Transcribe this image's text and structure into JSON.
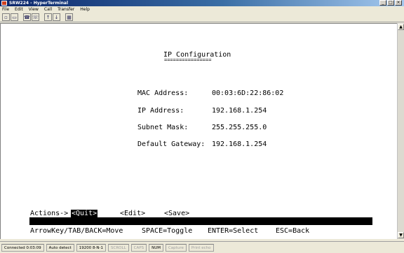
{
  "window": {
    "title": "SRW224 - HyperTerminal"
  },
  "menu": [
    "File",
    "Edit",
    "View",
    "Call",
    "Transfer",
    "Help"
  ],
  "toolbar": [
    "new-icon",
    "open-icon",
    "disconnect-icon",
    "connect-icon",
    "send-icon",
    "receive-icon",
    "properties-icon"
  ],
  "screen": {
    "title": "IP Configuration",
    "underline": "================",
    "fields": [
      {
        "label": "MAC Address:",
        "value": "00:03:6D:22:86:02"
      },
      {
        "label": "IP Address:",
        "value": "192.168.1.254"
      },
      {
        "label": "Subnet Mask:",
        "value": "255.255.255.0"
      },
      {
        "label": "Default Gateway:",
        "value": "192.168.1.254"
      }
    ],
    "actions_label": "Actions->",
    "actions": [
      "<Quit>",
      "<Edit>",
      "<Save>"
    ],
    "help": [
      "ArrowKey/TAB/BACK=Move",
      "SPACE=Toggle",
      "ENTER=Select",
      "ESC=Back"
    ]
  },
  "status": {
    "connected": "Connected 0:03:09",
    "detect": "Auto detect",
    "settings": "19200 8-N-1",
    "scroll": "SCROLL",
    "caps": "CAPS",
    "num": "NUM",
    "capture": "Capture",
    "print": "Print echo"
  }
}
